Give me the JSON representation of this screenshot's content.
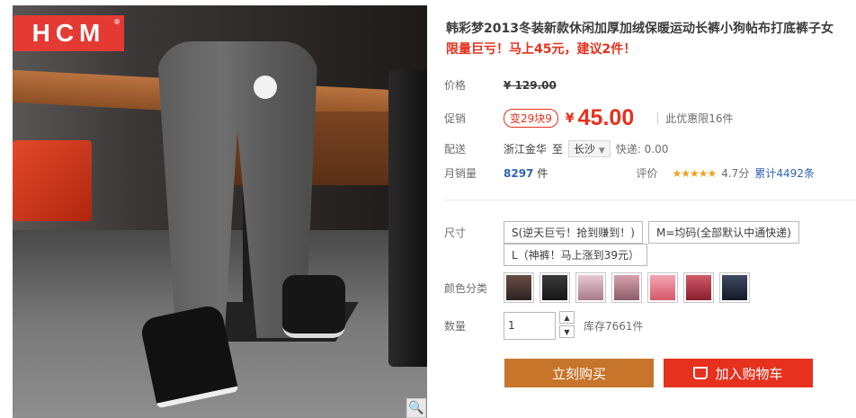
{
  "brand": {
    "logo_text": "HCM",
    "reg_mark": "®"
  },
  "product": {
    "title": "韩彩梦2013冬装新款休闲加厚加绒保暖运动长裤小狗帖布打底裤子女",
    "subtitle": "限量巨亏！马上45元，建议2件！"
  },
  "price_block": {
    "price_label": "价格",
    "original_price": "¥ 129.00",
    "promo_label": "促销",
    "promo_tag": "变29块9",
    "currency": "¥",
    "promo_price": "45.00",
    "limit_text": "此优惠限16件"
  },
  "shipping": {
    "label": "配送",
    "from": "浙江金华",
    "to_word": "至",
    "destination": "长沙",
    "fee": "快递: 0.00"
  },
  "sales": {
    "label": "月销量",
    "count": "8297",
    "unit": "件",
    "rating_label": "评价",
    "stars": "★★★★★",
    "score": "4.7分",
    "reviews": "累计4492条"
  },
  "size": {
    "label": "尺寸",
    "options": [
      "S(逆天巨亏！抢到赚到！)",
      "M=均码(全部默认中通快递)",
      "L（神裤！马上涨到39元）"
    ]
  },
  "color": {
    "label": "颜色分类",
    "swatches": [
      "#4a3a36",
      "#2e2e2e",
      "#c9a3b0",
      "#b07a86",
      "#d97a8a",
      "#b23a4a",
      "#2a3244"
    ]
  },
  "quantity": {
    "label": "数量",
    "value": "1",
    "stock": "库存7661件",
    "up": "▲",
    "down": "▼"
  },
  "actions": {
    "buy_now": "立刻购买",
    "add_cart": "加入购物车"
  },
  "zoom_icon": "🔍",
  "colors": {
    "accent": "#e5311e",
    "buy": "#c7752a",
    "link": "#2f64b2"
  }
}
